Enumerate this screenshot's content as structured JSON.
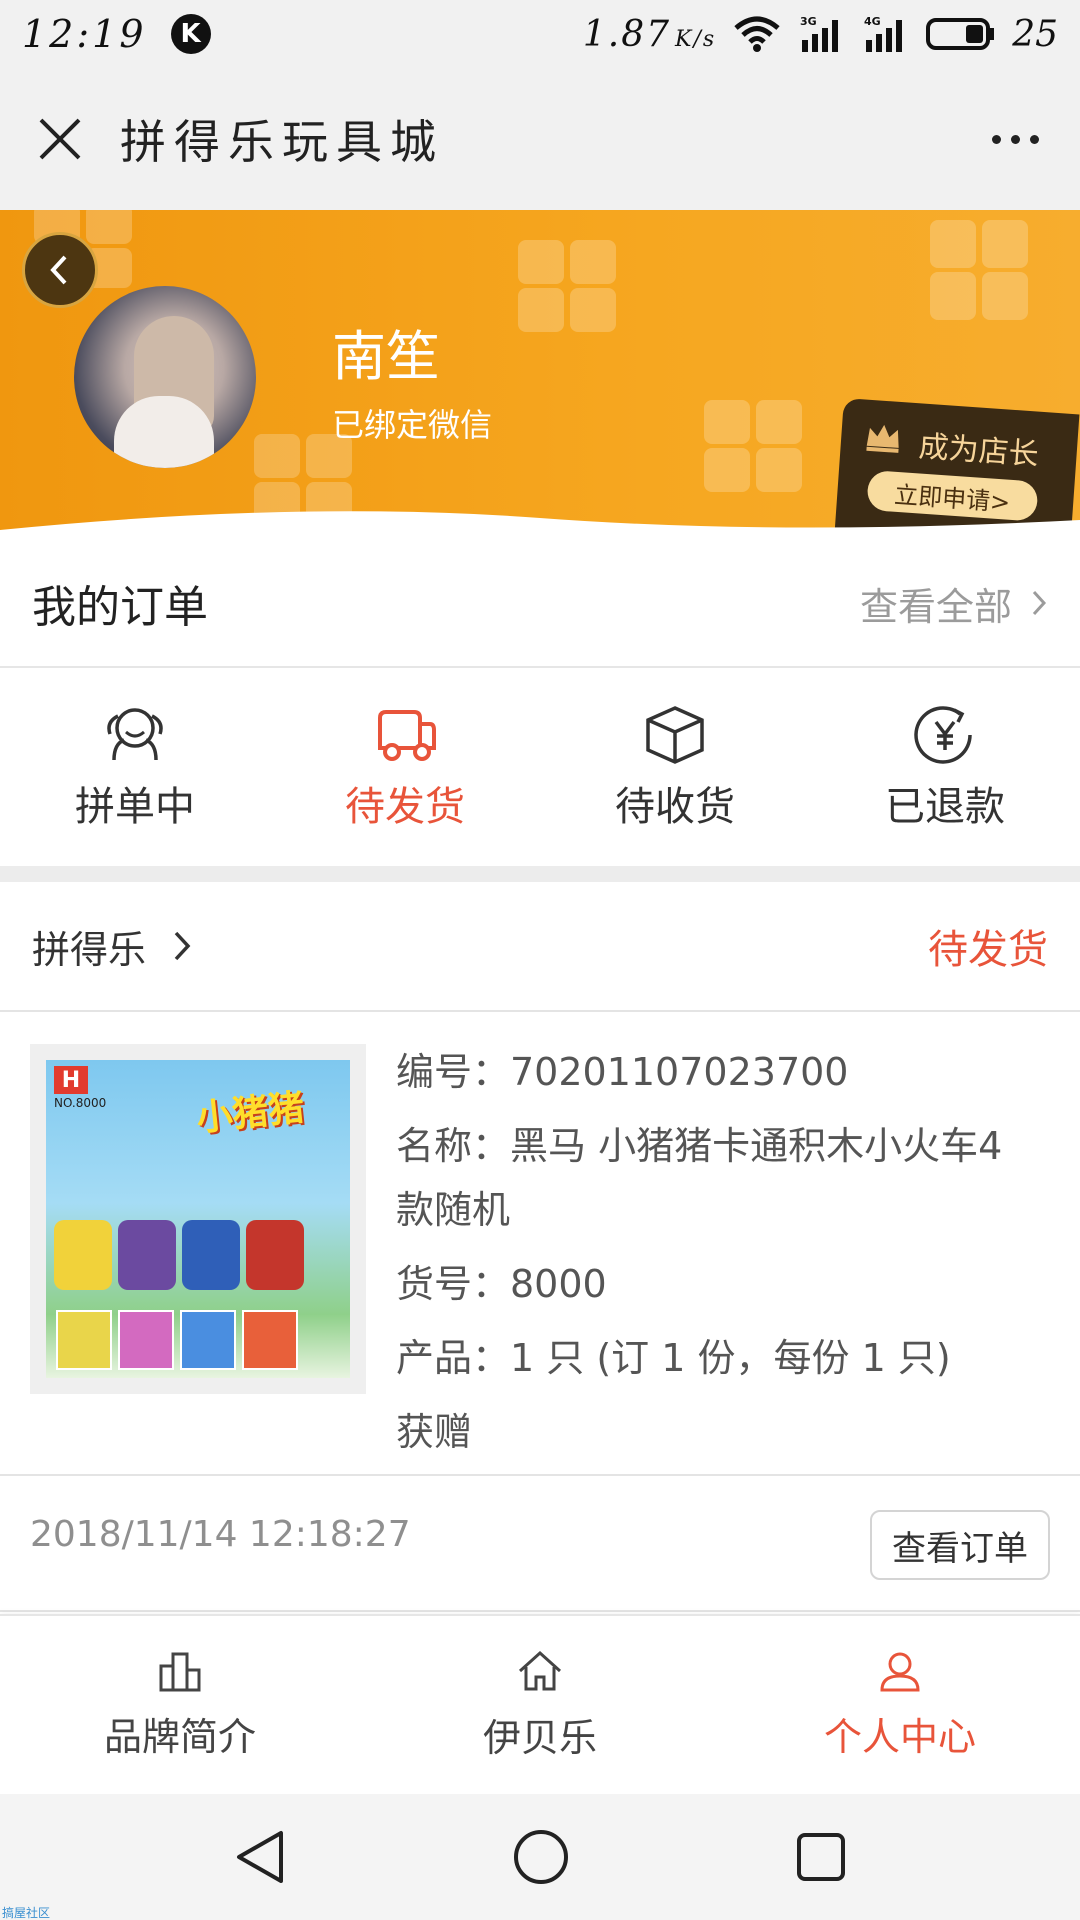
{
  "status_bar": {
    "time": "12:19",
    "app_badge": "K",
    "net_speed": "1.87",
    "net_unit": "K/s",
    "network_labels": [
      "3G",
      "4G"
    ],
    "battery": "25"
  },
  "title_bar": {
    "title": "拼得乐玩具城"
  },
  "profile": {
    "name": "南笙",
    "wechat_status": "已绑定微信",
    "shop_promo_title": "成为店长",
    "shop_promo_button": "立即申请>"
  },
  "orders": {
    "title": "我的订单",
    "view_all": "查看全部",
    "tabs": [
      {
        "label": "拼单中",
        "icon": "group-person-icon",
        "active": false
      },
      {
        "label": "待发货",
        "icon": "delivery-truck-icon",
        "active": true
      },
      {
        "label": "待收货",
        "icon": "package-box-icon",
        "active": false
      },
      {
        "label": "已退款",
        "icon": "yen-refund-icon",
        "active": false
      }
    ]
  },
  "order_card": {
    "shop_name": "拼得乐",
    "status": "待发货",
    "thumb": {
      "brand_logo": "H",
      "code": "NO.8000",
      "title_text": "小猪猪"
    },
    "serial": "编号：70201107023700",
    "name_line1": "名称：黑马 小猪猪卡通积木小火车4",
    "name_line2": "款随机",
    "item_no": "货号：8000",
    "product": "产品：1 只 (订 1 份，每份 1 只)",
    "gift": "获赠",
    "time": "2018/11/14 12:18:27",
    "view_button": "查看订单"
  },
  "bottom_nav": {
    "items": [
      {
        "label": "品牌简介",
        "icon": "building-chart-icon",
        "active": false
      },
      {
        "label": "伊贝乐",
        "icon": "home-icon",
        "active": false
      },
      {
        "label": "个人中心",
        "icon": "person-icon",
        "active": true
      }
    ]
  },
  "watermark": "搞屋社区",
  "colors": {
    "accent": "#e8543a",
    "header_orange": "#f0970f",
    "promo_dark": "#3a2a14",
    "promo_gold": "#f8dc9f"
  }
}
